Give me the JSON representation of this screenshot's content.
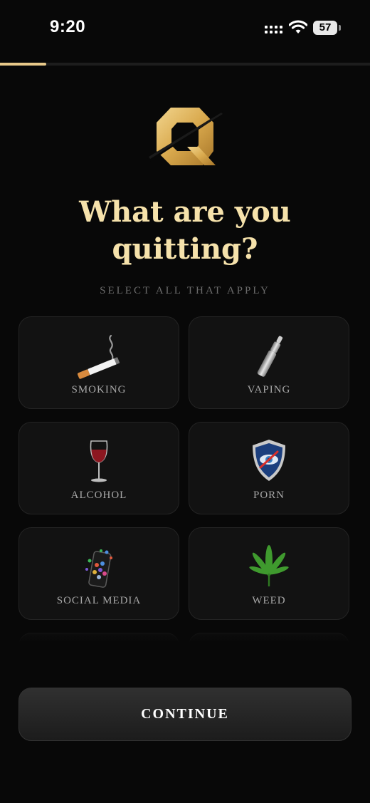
{
  "status_bar": {
    "time": "9:20",
    "battery": "57"
  },
  "progress": {
    "fraction": 0.125,
    "color": "#e8c98a"
  },
  "brand": {
    "logo_icon": "gold-q-logo-icon"
  },
  "header": {
    "title_line1": "What are you",
    "title_line2": "quitting?",
    "subtitle": "SELECT ALL THAT APPLY"
  },
  "options": [
    {
      "label": "SMOKING",
      "icon": "cigarette-icon",
      "selected": false
    },
    {
      "label": "VAPING",
      "icon": "vape-pen-icon",
      "selected": false
    },
    {
      "label": "ALCOHOL",
      "icon": "wine-glass-icon",
      "selected": false
    },
    {
      "label": "PORN",
      "icon": "blocked-eye-shield-icon",
      "selected": false
    },
    {
      "label": "SOCIAL MEDIA",
      "icon": "smartphone-apps-icon",
      "selected": false
    },
    {
      "label": "WEED",
      "icon": "cannabis-leaf-icon",
      "selected": false
    },
    {
      "label": "",
      "icon": "",
      "selected": false
    },
    {
      "label": "",
      "icon": "",
      "selected": false
    }
  ],
  "footer": {
    "continue_label": "CONTINUE"
  },
  "colors": {
    "accent_gold": "#f6e2ab",
    "background": "#080808",
    "card": "#121212"
  }
}
